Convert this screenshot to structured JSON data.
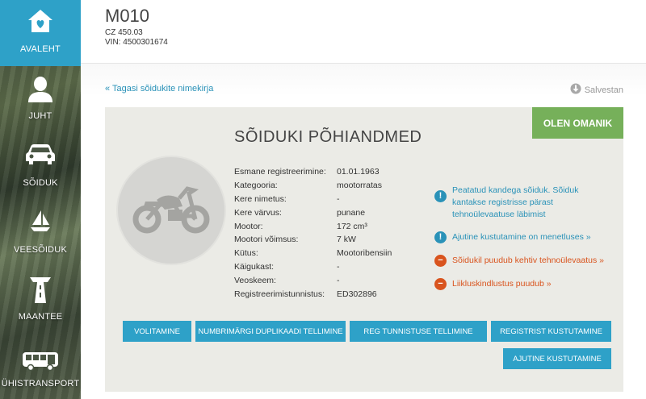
{
  "sidebar": {
    "items": [
      {
        "label": "AVALEHT",
        "icon": "home-heart-icon",
        "active": true
      },
      {
        "label": "JUHT",
        "icon": "person-icon"
      },
      {
        "label": "SÕIDUK",
        "icon": "car-icon"
      },
      {
        "label": "VEESÕIDUK",
        "icon": "sailboat-icon"
      },
      {
        "label": "MAANTEE",
        "icon": "road-icon"
      },
      {
        "label": "ÜHISTRANSPORT",
        "icon": "bus-icon"
      }
    ]
  },
  "header": {
    "plate": "M010",
    "model": "CZ 450.03",
    "vin": "VIN: 4500301674"
  },
  "nav": {
    "back_link": "« Tagasi sõidukite nimekirja",
    "save_label": "Salvestan"
  },
  "card": {
    "title": "SÕIDUKI PÕHIANDMED",
    "owner_button": "OLEN OMANIK",
    "vehicle_icon": "motorcycle-icon",
    "details": [
      {
        "label": "Esmane registreerimine:",
        "value": "01.01.1963"
      },
      {
        "label": "Kategooria:",
        "value": "mootorratas"
      },
      {
        "label": "Kere nimetus:",
        "value": "-"
      },
      {
        "label": "Kere värvus:",
        "value": "punane"
      },
      {
        "label": "Mootor:",
        "value": "172 cm³"
      },
      {
        "label": "Mootori võimsus:",
        "value": "7 kW"
      },
      {
        "label": "Kütus:",
        "value": "Mootoribensiin"
      },
      {
        "label": "Käigukast:",
        "value": "-"
      },
      {
        "label": "Veoskeem:",
        "value": "-"
      },
      {
        "label": "Registreerimistunnistus:",
        "value": "ED302896"
      }
    ],
    "notices": [
      {
        "text": "Peatatud kandega sõiduk. Sõiduk kantakse registrisse pärast tehnoülevaatuse läbimist",
        "type": "info",
        "symbol": "!"
      },
      {
        "text": "Ajutine kustutamine on menetluses »",
        "type": "info",
        "symbol": "!"
      },
      {
        "text": "Sõidukil puudub kehtiv tehnoülevaatus »",
        "type": "warn",
        "symbol": "−"
      },
      {
        "text": "Liikluskindlustus puudub »",
        "type": "warn",
        "symbol": "−"
      }
    ],
    "buttons": [
      "VOLITAMINE",
      "NUMBRIMÄRGI DUPLIKAADI TELLIMINE",
      "REG TUNNISTUSE TELLIMINE",
      "REGISTRIST KUSTUTAMINE",
      "AJUTINE KUSTUTAMINE"
    ]
  },
  "colors": {
    "accent": "#2ea1c8",
    "owner_green": "#76b05a",
    "warning": "#d9541e",
    "card_bg": "#ebebe6"
  }
}
